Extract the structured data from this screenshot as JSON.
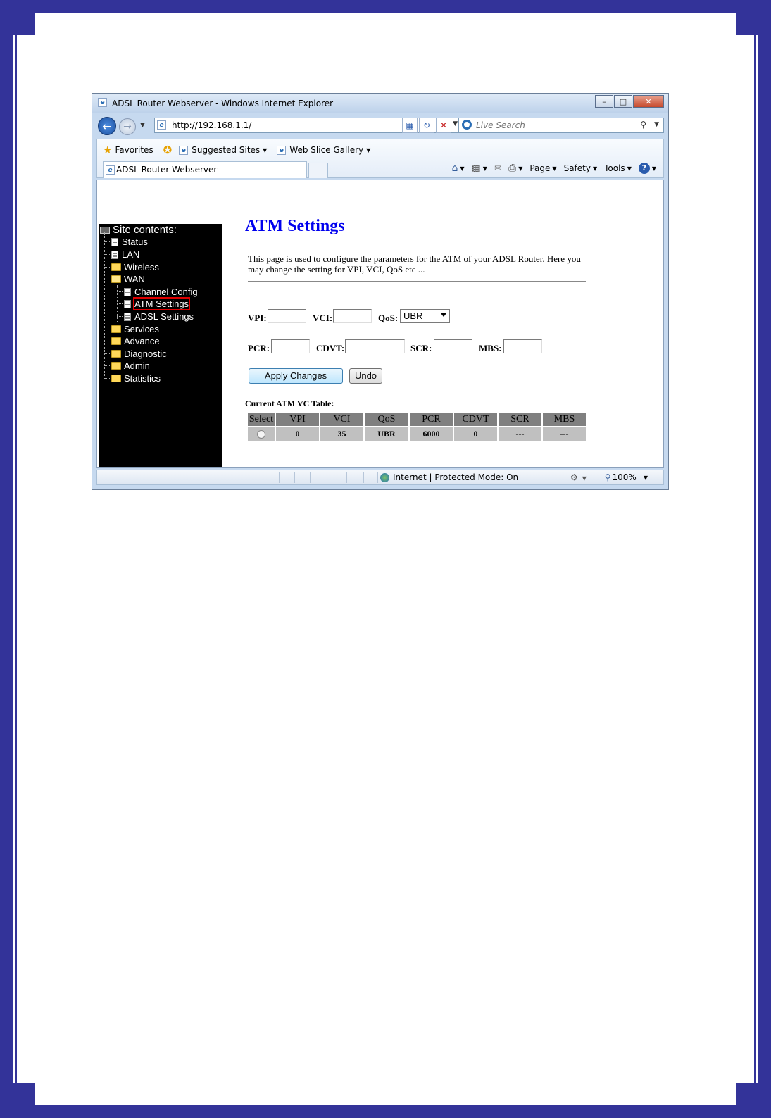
{
  "window": {
    "title": "ADSL Router Webserver - Windows Internet Explorer",
    "address": "http://192.168.1.1/",
    "search_placeholder": "Live Search"
  },
  "favorites_bar": {
    "favorites": "Favorites",
    "suggested_sites": "Suggested Sites",
    "web_slice_gallery": "Web Slice Gallery"
  },
  "tab": {
    "label": "ADSL Router Webserver"
  },
  "command_bar": {
    "page": "Page",
    "safety": "Safety",
    "tools": "Tools"
  },
  "sidebar": {
    "root": "Site contents:",
    "items": [
      {
        "label": "Status"
      },
      {
        "label": "LAN"
      },
      {
        "label": "Wireless"
      },
      {
        "label": "WAN"
      },
      {
        "label": "Channel Config"
      },
      {
        "label": "ATM Settings"
      },
      {
        "label": "ADSL Settings"
      },
      {
        "label": "Services"
      },
      {
        "label": "Advance"
      },
      {
        "label": "Diagnostic"
      },
      {
        "label": "Admin"
      },
      {
        "label": "Statistics"
      }
    ]
  },
  "main": {
    "title": "ATM Settings",
    "description": "This page is used to configure the parameters for the ATM of your ADSL Router. Here you may change the setting for VPI, VCI, QoS etc ...",
    "labels": {
      "vpi": "VPI:",
      "vci": "VCI:",
      "qos": "QoS:",
      "pcr": "PCR:",
      "cdvt": "CDVT:",
      "scr": "SCR:",
      "mbs": "MBS:"
    },
    "qos_selected": "UBR",
    "apply_button": "Apply Changes",
    "undo_button": "Undo",
    "table_title": "Current ATM VC Table:",
    "table_headers": [
      "Select",
      "VPI",
      "VCI",
      "QoS",
      "PCR",
      "CDVT",
      "SCR",
      "MBS"
    ],
    "table_rows": [
      {
        "vpi": "0",
        "vci": "35",
        "qos": "UBR",
        "pcr": "6000",
        "cdvt": "0",
        "scr": "---",
        "mbs": "---"
      }
    ]
  },
  "status_bar": {
    "zone": "Internet | Protected Mode: On",
    "zoom": "100%"
  },
  "colors": {
    "frame": "#333399",
    "title_blue": "#0000ee",
    "sidebar_bg": "#000000",
    "highlight": "#e00000"
  }
}
